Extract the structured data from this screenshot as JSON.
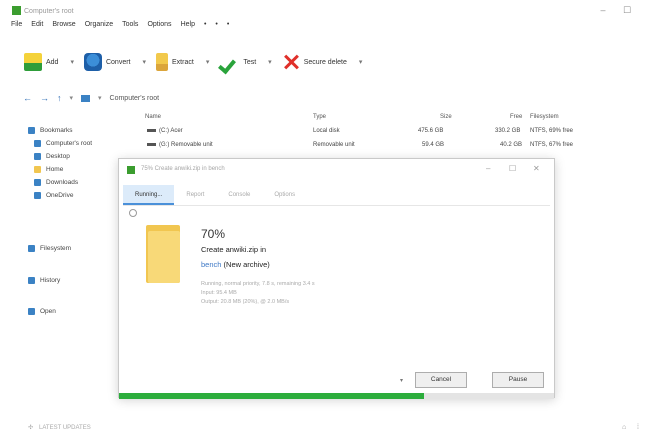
{
  "window": {
    "title": "Computer's root"
  },
  "menu": [
    "File",
    "Edit",
    "Browse",
    "Organize",
    "Tools",
    "Options",
    "Help",
    "•",
    "•",
    "•"
  ],
  "toolbar": {
    "items": [
      {
        "label": "Add",
        "icon": "add-archive-icon"
      },
      {
        "label": "Convert",
        "icon": "convert-icon"
      },
      {
        "label": "Extract",
        "icon": "extract-icon"
      },
      {
        "label": "Test",
        "icon": "test-checkmark-icon"
      },
      {
        "label": "Secure delete",
        "icon": "secure-delete-icon"
      }
    ],
    "dropdown_glyph": "▾"
  },
  "address": {
    "crumb": "Computer's root"
  },
  "sidebar": [
    {
      "label": "Bookmarks",
      "color": "#3b82c4"
    },
    {
      "label": "Computer's root",
      "color": "#3b82c4"
    },
    {
      "label": "Desktop",
      "color": "#3b82c4"
    },
    {
      "label": "Home",
      "color": "#f1c650"
    },
    {
      "label": "Downloads",
      "color": "#3b82c4"
    },
    {
      "label": "OneDrive",
      "color": "#3b82c4"
    },
    {
      "label": "Filesystem",
      "color": "#3b82c4"
    },
    {
      "label": "History",
      "color": "#3b82c4"
    },
    {
      "label": "Open",
      "color": "#3b82c4"
    }
  ],
  "file_list": {
    "headers": {
      "name": "Name",
      "type": "Type",
      "size": "Size",
      "free": "Free",
      "fs": "Filesystem"
    },
    "rows": [
      {
        "name": "(C:) Acer",
        "type": "Local disk",
        "size": "475.6 GB",
        "free": "330.2 GB",
        "fs": "NTFS, 69% free"
      },
      {
        "name": "(G:) Removable unit",
        "type": "Removable unit",
        "size": "59.4 GB",
        "free": "40.2 GB",
        "fs": "NTFS, 67% free"
      }
    ]
  },
  "dialog": {
    "title": "75% Create anwiki.zip in bench",
    "tabs": [
      "Running...",
      "Report",
      "Console",
      "Options"
    ],
    "percent": "70%",
    "action": "Create anwiki.zip in",
    "target_link": "bench",
    "target_suffix": "(New archive)",
    "details": [
      "Running, normal priority, 7.8 s, remaining 3.4 s",
      "Input: 95.4 MB",
      "Output: 20.8 MB (20%), @ 2.0 MB/s"
    ],
    "cancel_label": "Cancel",
    "pause_label": "Pause",
    "progress": 0.7
  },
  "status": {
    "left": "LATEST UPDATES",
    "right": "⌂"
  }
}
